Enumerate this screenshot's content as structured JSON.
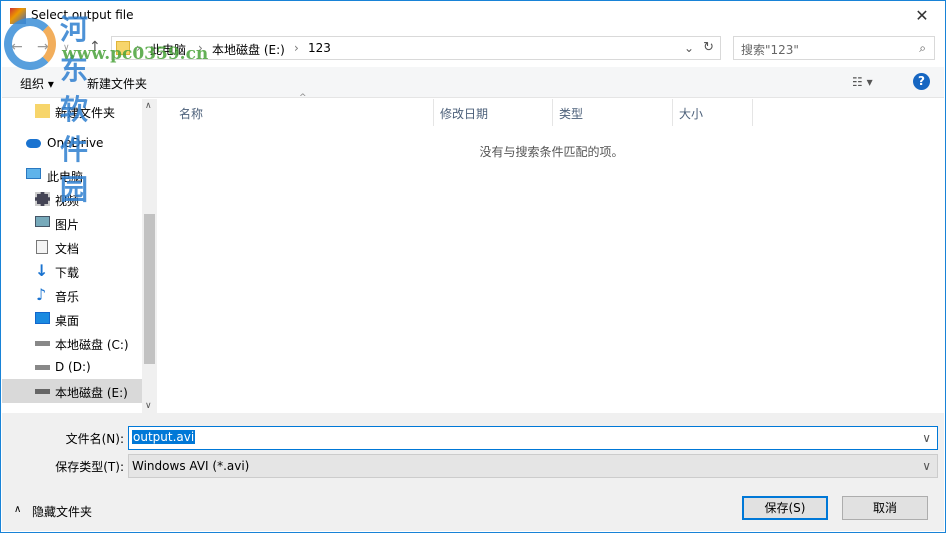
{
  "window": {
    "title": "Select output file",
    "close": "✕"
  },
  "address": {
    "crumbs": [
      "此电脑",
      "本地磁盘 (E:)",
      "123"
    ],
    "search_placeholder": "搜索\"123\""
  },
  "toolbar": {
    "organize": "组织 ▾",
    "new_folder": "新建文件夹",
    "view": "☷ ▾",
    "help": "?"
  },
  "nav": [
    {
      "label": "新建文件夹",
      "icon": "folder-icon"
    },
    {
      "label": "OneDrive",
      "icon": "cloud-icon"
    },
    {
      "label": "此电脑",
      "icon": "computer-icon"
    },
    {
      "label": "视频",
      "icon": "video-icon"
    },
    {
      "label": "图片",
      "icon": "pictures-icon"
    },
    {
      "label": "文档",
      "icon": "document-icon"
    },
    {
      "label": "下载",
      "icon": "download-icon"
    },
    {
      "label": "音乐",
      "icon": "music-icon"
    },
    {
      "label": "桌面",
      "icon": "desktop-icon"
    },
    {
      "label": "本地磁盘 (C:)",
      "icon": "drive-icon"
    },
    {
      "label": "D (D:)",
      "icon": "drive-icon"
    },
    {
      "label": "本地磁盘 (E:)",
      "icon": "drive-icon",
      "selected": true
    }
  ],
  "columns": [
    "名称",
    "修改日期",
    "类型",
    "大小"
  ],
  "empty_message": "没有与搜索条件匹配的项。",
  "form": {
    "filename_label": "文件名(N):",
    "filename_value": "output.avi",
    "filetype_label": "保存类型(T):",
    "filetype_value": "Windows AVI  (*.avi)"
  },
  "footer": {
    "hide_folders": "隐藏文件夹",
    "save": "保存(S)",
    "cancel": "取消"
  },
  "watermark": {
    "name": "河东软件园",
    "url": "www.pc0359.cn"
  }
}
